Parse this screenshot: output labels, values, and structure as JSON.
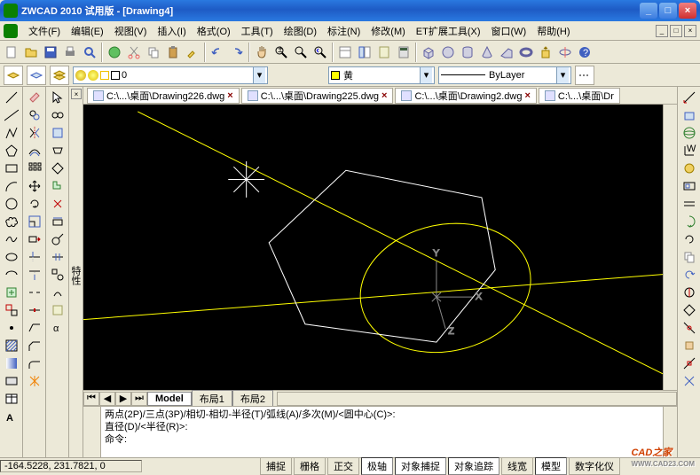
{
  "title": "ZWCAD 2010 试用版 - [Drawing4]",
  "menu": {
    "file": "文件(F)",
    "edit": "编辑(E)",
    "view": "视图(V)",
    "insert": "插入(I)",
    "format": "格式(O)",
    "tools": "工具(T)",
    "draw": "绘图(D)",
    "dimension": "标注(N)",
    "modify": "修改(M)",
    "et": "ET扩展工具(X)",
    "window": "窗口(W)",
    "help": "帮助(H)"
  },
  "layer": {
    "name": "0"
  },
  "color": {
    "name": "黄"
  },
  "linetype": {
    "name": "ByLayer"
  },
  "panel": {
    "title": "特性"
  },
  "doctabs": [
    {
      "label": "C:\\...\\桌面\\Drawing226.dwg"
    },
    {
      "label": "C:\\...\\桌面\\Drawing225.dwg"
    },
    {
      "label": "C:\\...\\桌面\\Drawing2.dwg"
    },
    {
      "label": "C:\\...\\桌面\\Dr"
    }
  ],
  "sheets": {
    "model": "Model",
    "layout1": "布局1",
    "layout2": "布局2"
  },
  "cmd": {
    "line1": "两点(2P)/三点(3P)/相切-相切-半径(T)/弧线(A)/多次(M)/<圆中心(C)>:",
    "line2": "直径(D)/<半径(R)>:",
    "line3": "命令:"
  },
  "status": {
    "coords": "-164.5228, 231.7821, 0",
    "snap": "捕捉",
    "grid": "栅格",
    "ortho": "正交",
    "polar": "极轴",
    "osnap": "对象捕捉",
    "otrack": "对象追踪",
    "lwt": "线宽",
    "model": "模型",
    "tablet": "数字化仪"
  },
  "logo": {
    "main": "CAD之家",
    "sub": "WWW.CAD23.COM"
  }
}
